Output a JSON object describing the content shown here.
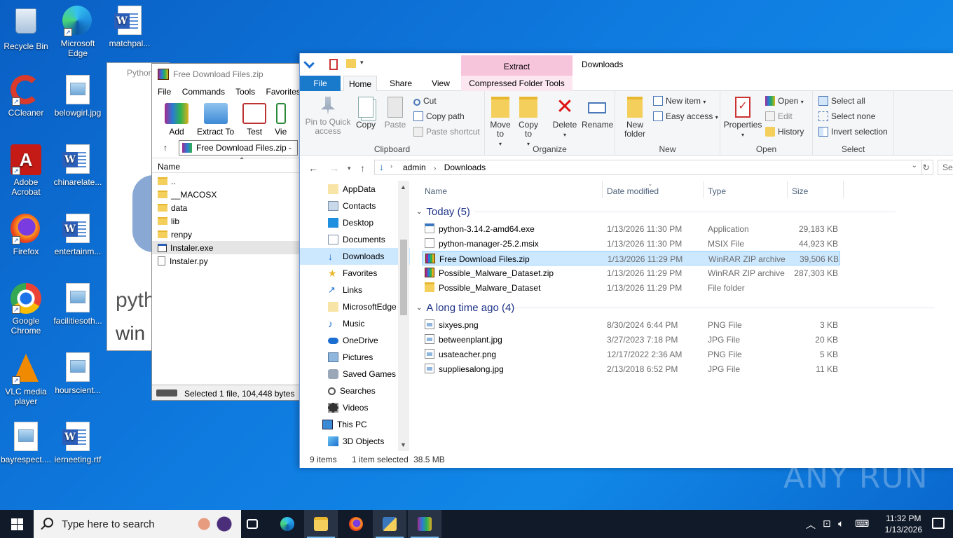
{
  "desktop": {
    "icons": [
      {
        "label": "Recycle Bin"
      },
      {
        "label": "Microsoft Edge"
      },
      {
        "label": "matchpal..."
      },
      {
        "label": "CCleaner"
      },
      {
        "label": "belowgirl.jpg"
      },
      {
        "label": "Adobe Acrobat"
      },
      {
        "label": "chinarelate..."
      },
      {
        "label": "Firefox"
      },
      {
        "label": "entertainm..."
      },
      {
        "label": "Google Chrome"
      },
      {
        "label": "facilitiesoth..."
      },
      {
        "label": "VLC media player"
      },
      {
        "label": "hourscient..."
      },
      {
        "label": "bayrespect...."
      },
      {
        "label": "ierneeting.rtf"
      }
    ]
  },
  "python_window": {
    "title": "Pythor",
    "text1": "pyth",
    "text2": "win"
  },
  "winrar": {
    "title": "Free Download Files.zip",
    "menu": [
      "File",
      "Commands",
      "Tools",
      "Favorites"
    ],
    "tools": [
      "Add",
      "Extract To",
      "Test",
      "Vie"
    ],
    "address": "Free Download Files.zip -",
    "column_name": "Name",
    "rows": [
      "..",
      "__MACOSX",
      "data",
      "lib",
      "renpy",
      "Instaler.exe",
      "Instaler.py"
    ],
    "status": "Selected 1 file, 104,448 bytes"
  },
  "explorer": {
    "window_title": "Downloads",
    "contextual_tab": "Extract",
    "tabs": {
      "file": "File",
      "home": "Home",
      "share": "Share",
      "view": "View",
      "compressed": "Compressed Folder Tools"
    },
    "ribbon": {
      "clipboard": {
        "pin": "Pin to Quick access",
        "copy": "Copy",
        "paste": "Paste",
        "cut": "Cut",
        "copy_path": "Copy path",
        "paste_shortcut": "Paste shortcut",
        "label": "Clipboard"
      },
      "organize": {
        "move_to": "Move to",
        "copy_to": "Copy to",
        "delete": "Delete",
        "rename": "Rename",
        "label": "Organize"
      },
      "new": {
        "new_folder": "New folder",
        "new_item": "New item",
        "easy_access": "Easy access",
        "label": "New"
      },
      "open": {
        "properties": "Properties",
        "open": "Open",
        "edit": "Edit",
        "history": "History",
        "label": "Open"
      },
      "select": {
        "select_all": "Select all",
        "select_none": "Select none",
        "invert": "Invert selection",
        "label": "Select"
      }
    },
    "breadcrumb": [
      "admin",
      "Downloads"
    ],
    "search_placeholder": "Sea",
    "nav_items": [
      "AppData",
      "Contacts",
      "Desktop",
      "Documents",
      "Downloads",
      "Favorites",
      "Links",
      "MicrosoftEdge",
      "Music",
      "OneDrive",
      "Pictures",
      "Saved Games",
      "Searches",
      "Videos",
      "This PC",
      "3D Objects"
    ],
    "columns": {
      "name": "Name",
      "date": "Date modified",
      "type": "Type",
      "size": "Size"
    },
    "groups": [
      {
        "title": "Today (5)",
        "files": [
          {
            "name": "python-3.14.2-amd64.exe",
            "date": "1/13/2026 11:30 PM",
            "type": "Application",
            "size": "29,183 KB"
          },
          {
            "name": "python-manager-25.2.msix",
            "date": "1/13/2026 11:30 PM",
            "type": "MSIX File",
            "size": "44,923 KB"
          },
          {
            "name": "Free Download Files.zip",
            "date": "1/13/2026 11:29 PM",
            "type": "WinRAR ZIP archive",
            "size": "39,506 KB"
          },
          {
            "name": "Possible_Malware_Dataset.zip",
            "date": "1/13/2026 11:29 PM",
            "type": "WinRAR ZIP archive",
            "size": "287,303 KB"
          },
          {
            "name": "Possible_Malware_Dataset",
            "date": "1/13/2026 11:29 PM",
            "type": "File folder",
            "size": ""
          }
        ]
      },
      {
        "title": "A long time ago (4)",
        "files": [
          {
            "name": "sixyes.png",
            "date": "8/30/2024 6:44 PM",
            "type": "PNG File",
            "size": "3 KB"
          },
          {
            "name": "betweenplant.jpg",
            "date": "3/27/2023 7:18 PM",
            "type": "JPG File",
            "size": "20 KB"
          },
          {
            "name": "usateacher.png",
            "date": "12/17/2022 2:36 AM",
            "type": "PNG File",
            "size": "5 KB"
          },
          {
            "name": "suppliesalong.jpg",
            "date": "2/13/2018 6:52 PM",
            "type": "JPG File",
            "size": "11 KB"
          }
        ]
      }
    ],
    "status": {
      "count": "9 items",
      "selected": "1 item selected",
      "size": "38.5 MB"
    }
  },
  "watermark": "ANY RUN",
  "taskbar": {
    "search_placeholder": "Type here to search",
    "time": "11:32 PM",
    "date": "1/13/2026"
  }
}
